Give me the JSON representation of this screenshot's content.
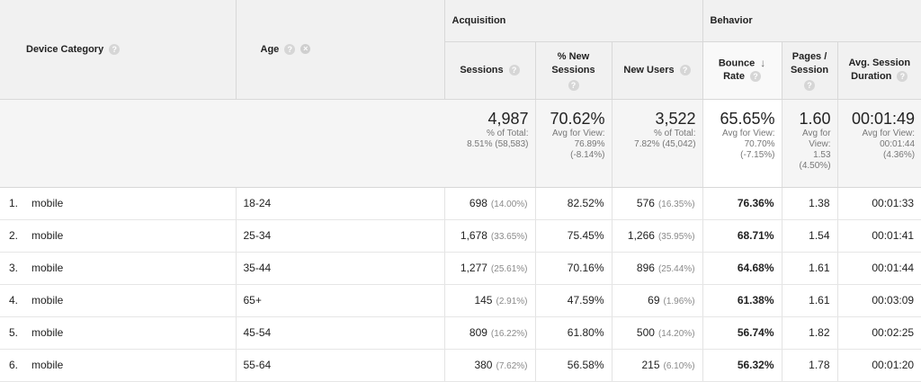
{
  "header": {
    "dimension1": "Device Category",
    "dimension2": "Age",
    "group_acquisition": "Acquisition",
    "group_behavior": "Behavior",
    "metrics": {
      "sessions": "Sessions",
      "pct_new_sessions_1": "% New",
      "pct_new_sessions_2": "Sessions",
      "new_users": "New Users",
      "bounce_rate_1": "Bounce",
      "bounce_rate_2": "Rate",
      "pages_session_1": "Pages /",
      "pages_session_2": "Session",
      "avg_duration_1": "Avg. Session",
      "avg_duration_2": "Duration"
    },
    "help_glyph": "?",
    "remove_glyph": "×",
    "sort_glyph": "↓"
  },
  "totals": {
    "sessions": {
      "value": "4,987",
      "sub1": "% of Total:",
      "sub2": "8.51% (58,583)"
    },
    "pct_new_sessions": {
      "value": "70.62%",
      "sub1": "Avg for View:",
      "sub2": "76.89%",
      "sub3": "(-8.14%)"
    },
    "new_users": {
      "value": "3,522",
      "sub1": "% of Total:",
      "sub2": "7.82% (45,042)"
    },
    "bounce_rate": {
      "value": "65.65%",
      "sub1": "Avg for View:",
      "sub2": "70.70%",
      "sub3": "(-7.15%)"
    },
    "pages_session": {
      "value": "1.60",
      "sub1": "Avg for",
      "sub2": "View:",
      "sub3": "1.53",
      "sub4": "(4.50%)"
    },
    "avg_duration": {
      "value": "00:01:49",
      "sub1": "Avg for View:",
      "sub2": "00:01:44",
      "sub3": "(4.36%)"
    }
  },
  "rows": [
    {
      "idx": "1.",
      "device": "mobile",
      "age": "18-24",
      "sessions": "698",
      "sessions_pct": "(14.00%)",
      "pct_new": "82.52%",
      "new_users": "576",
      "new_users_pct": "(16.35%)",
      "bounce": "76.36%",
      "pages": "1.38",
      "duration": "00:01:33"
    },
    {
      "idx": "2.",
      "device": "mobile",
      "age": "25-34",
      "sessions": "1,678",
      "sessions_pct": "(33.65%)",
      "pct_new": "75.45%",
      "new_users": "1,266",
      "new_users_pct": "(35.95%)",
      "bounce": "68.71%",
      "pages": "1.54",
      "duration": "00:01:41"
    },
    {
      "idx": "3.",
      "device": "mobile",
      "age": "35-44",
      "sessions": "1,277",
      "sessions_pct": "(25.61%)",
      "pct_new": "70.16%",
      "new_users": "896",
      "new_users_pct": "(25.44%)",
      "bounce": "64.68%",
      "pages": "1.61",
      "duration": "00:01:44"
    },
    {
      "idx": "4.",
      "device": "mobile",
      "age": "65+",
      "sessions": "145",
      "sessions_pct": "(2.91%)",
      "pct_new": "47.59%",
      "new_users": "69",
      "new_users_pct": "(1.96%)",
      "bounce": "61.38%",
      "pages": "1.61",
      "duration": "00:03:09"
    },
    {
      "idx": "5.",
      "device": "mobile",
      "age": "45-54",
      "sessions": "809",
      "sessions_pct": "(16.22%)",
      "pct_new": "61.80%",
      "new_users": "500",
      "new_users_pct": "(14.20%)",
      "bounce": "56.74%",
      "pages": "1.82",
      "duration": "00:02:25"
    },
    {
      "idx": "6.",
      "device": "mobile",
      "age": "55-64",
      "sessions": "380",
      "sessions_pct": "(7.62%)",
      "pct_new": "56.58%",
      "new_users": "215",
      "new_users_pct": "(6.10%)",
      "bounce": "56.32%",
      "pages": "1.78",
      "duration": "00:01:20"
    }
  ]
}
